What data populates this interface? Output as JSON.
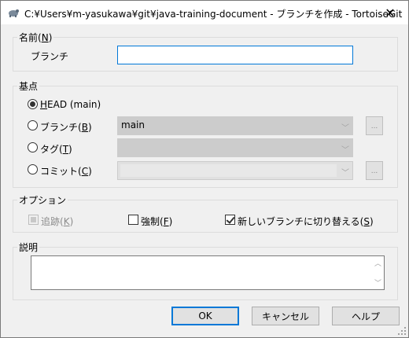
{
  "window": {
    "title": "C:¥Users¥m-yasukawa¥git¥java-training-document - ブランチを作成 - TortoiseGit",
    "close_glyph": "✕",
    "app_icon": "tortoisegit-icon"
  },
  "name_group": {
    "label": "名前",
    "accel": "N",
    "branch_label": "ブランチ",
    "branch_value": ""
  },
  "base_group": {
    "label": "基点",
    "head_label_accel": "H",
    "head_label_rest": "EAD (main)",
    "branch_label": "ブランチ",
    "branch_accel": "B",
    "branch_value": "main",
    "tag_label": "タグ",
    "tag_accel": "T",
    "tag_value": "",
    "commit_label": "コミット",
    "commit_accel": "C",
    "commit_value": "",
    "browse_label": "...",
    "selected": "HEAD (main)"
  },
  "options_group": {
    "label": "オプション",
    "track_label": "追跡",
    "track_accel": "K",
    "track_checked": false,
    "track_enabled": false,
    "force_label": "強制",
    "force_accel": "F",
    "force_checked": false,
    "switch_label": "新しいブランチに切り替える",
    "switch_accel": "S",
    "switch_checked": true
  },
  "desc_group": {
    "label": "説明",
    "value": ""
  },
  "buttons": {
    "ok": "OK",
    "cancel": "キャンセル",
    "help": "ヘルプ"
  }
}
